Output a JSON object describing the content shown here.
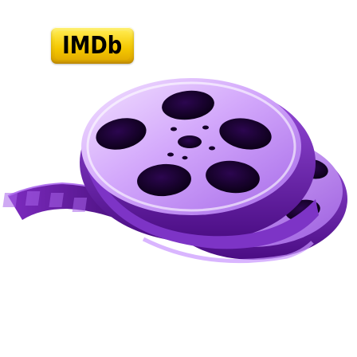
{
  "logo": {
    "text": "IMDb",
    "color": "#f5c518"
  },
  "illustration": {
    "icon": "film-reel-icon",
    "colors": {
      "reel_light": "#e9c8ff",
      "reel_mid": "#b47ff0",
      "reel_dark": "#6a1ba8",
      "film_strip": "#5a1190",
      "holes": "#15002a"
    }
  }
}
